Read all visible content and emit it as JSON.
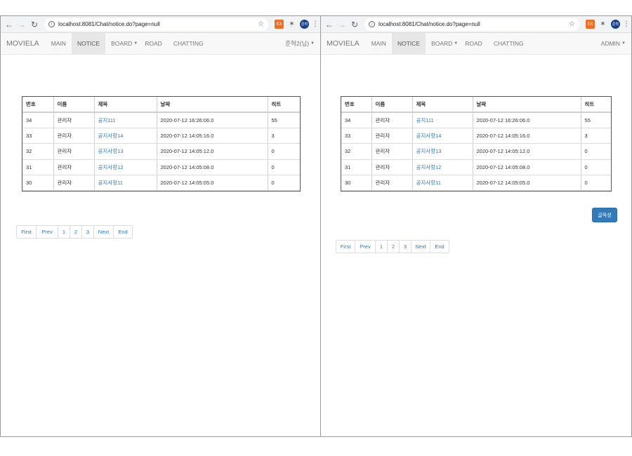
{
  "windows": [
    {
      "url": "localhost:8081/Chat/notice.do?page=null",
      "navbar": {
        "brand": "MOVIELA",
        "items": [
          {
            "label": "MAIN"
          },
          {
            "label": "NOTICE"
          },
          {
            "label": "BOARD"
          },
          {
            "label": "ROAD"
          },
          {
            "label": "CHATTING"
          }
        ],
        "user": "준혁2(님)"
      }
    },
    {
      "url": "localhost:8081/Chat/notice.do?page=null",
      "navbar": {
        "brand": "MOVIELA",
        "items": [
          {
            "label": "MAIN"
          },
          {
            "label": "NOTICE"
          },
          {
            "label": "BOARD"
          },
          {
            "label": "ROAD"
          },
          {
            "label": "CHATTING"
          }
        ],
        "user": "ADMIN"
      },
      "write_button": "글작성"
    }
  ],
  "browser": {
    "avatar_text": "준혁",
    "ext_text": "EX"
  },
  "table": {
    "headers": [
      "번호",
      "이름",
      "제목",
      "날짜",
      "히트"
    ],
    "rows": [
      [
        "34",
        "관리자",
        "공지111",
        "2020-07-12 16:26:06.0",
        "55"
      ],
      [
        "33",
        "관리자",
        "공지사항14",
        "2020-07-12 14:05:16.0",
        "3"
      ],
      [
        "32",
        "관리자",
        "공지사항13",
        "2020-07-12 14:05:12.0",
        "0"
      ],
      [
        "31",
        "관리자",
        "공지사항12",
        "2020-07-12 14:05:08.0",
        "0"
      ],
      [
        "30",
        "관리자",
        "공지사항11",
        "2020-07-12 14:05:05.0",
        "0"
      ]
    ]
  },
  "pagination": [
    "First",
    "Prev",
    "1",
    "2",
    "3",
    "Next",
    "End"
  ],
  "icons": {
    "back": "back-arrow-icon",
    "forward": "forward-arrow-icon",
    "reload": "reload-icon",
    "info": "info-icon",
    "star": "bookmark-star-icon",
    "puzzle": "extensions-puzzle-icon",
    "menu": "kebab-menu-icon"
  },
  "colors": {
    "link": "#337ab7",
    "button": "#337ab7",
    "navbar_bg": "#f8f8f8",
    "nav_active_bg": "#e7e7e7"
  }
}
